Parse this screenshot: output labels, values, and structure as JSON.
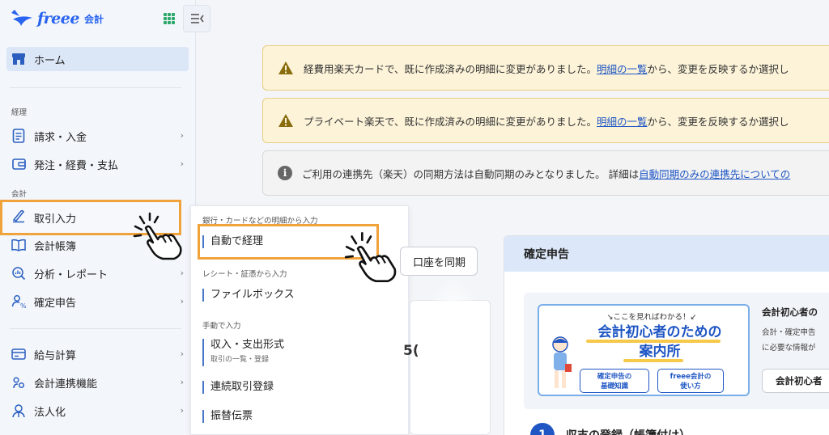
{
  "app": {
    "logo_word": "freee",
    "logo_sub": "会計"
  },
  "sidebar": {
    "home_label": "ホーム",
    "section_keiri": "経理",
    "section_kaikei": "会計",
    "items_keiri": [
      {
        "label": "請求・入金",
        "icon": "invoice-icon"
      },
      {
        "label": "発注・経費・支払",
        "icon": "wallet-icon"
      }
    ],
    "active_item": {
      "label": "取引入力",
      "icon": "pen-icon"
    },
    "items_kaikei": [
      {
        "label": "会計帳簿",
        "icon": "book-icon"
      },
      {
        "label": "分析・レポート",
        "icon": "analysis-icon"
      },
      {
        "label": "確定申告",
        "icon": "person-yen-icon"
      }
    ],
    "items_other": [
      {
        "label": "給与計算",
        "icon": "card-icon"
      },
      {
        "label": "会計連携機能",
        "icon": "link-icon"
      },
      {
        "label": "法人化",
        "icon": "building-icon"
      }
    ]
  },
  "flyout": {
    "section_bank": "銀行・カードなどの明細から入力",
    "auto": "自動で経理",
    "section_receipt": "レシート・証憑から入力",
    "filebox": "ファイルボックス",
    "section_manual": "手動で入力",
    "income": "収入・支出形式",
    "income_sub": "取引の一覧・登録",
    "continuous": "連続取引登録",
    "transfer": "振替伝票"
  },
  "notices": [
    {
      "type": "warning",
      "before": "経費用楽天カードで、既に作成済みの明細に変更がありました。",
      "link": "明細の一覧",
      "after": "から、変更を反映するか選択し"
    },
    {
      "type": "warning",
      "before": "プライベート楽天で、既に作成済みの明細に変更がありました。",
      "link": "明細の一覧",
      "after": "から、変更を反映するか選択し"
    },
    {
      "type": "info",
      "before": "ご利用の連携先（楽天）の同期方法は自動同期のみとなりました。 詳細は",
      "link": "自動同期のみの連携先についての",
      "after": ""
    }
  ],
  "main": {
    "sync_button": "口座を同期",
    "fragment_number": "5(",
    "panel_title": "確定申告",
    "banner": {
      "top": "ここを見ればわかる！",
      "title1": "会計初心者のための",
      "title2": "案内所",
      "btn1": "確定申告の\n基礎知識",
      "btn2": "freee会計の\n使い方"
    },
    "beginner_title": "会計初心者の",
    "beginner_line1": "会計・確定申告",
    "beginner_line2": "に必要な情報が",
    "beginner_button": "会計初心者",
    "step_number": "1",
    "step_label": "収支の登録（帳簿付け）"
  },
  "colors": {
    "accent": "#1f56c4",
    "highlight": "#f0a23b",
    "warning_bg": "#fcf3d8",
    "panel_head": "#dce8f9"
  }
}
